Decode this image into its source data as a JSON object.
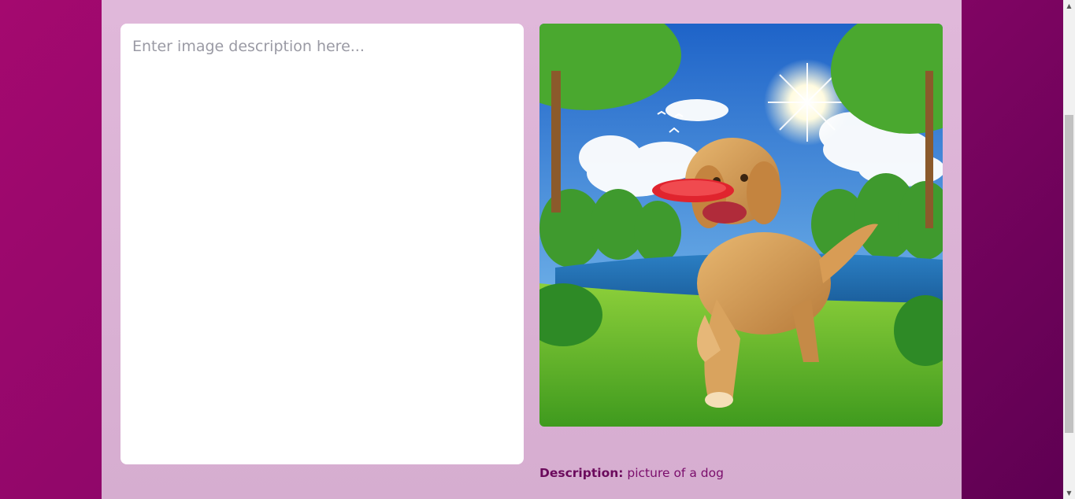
{
  "form": {
    "description_placeholder": "Enter image description here..."
  },
  "image": {
    "subject": "golden retriever with red frisbee in park",
    "alt": "picture of a dog"
  },
  "caption": {
    "label": "Description:",
    "value": "picture of a dog"
  },
  "colors": {
    "background_start": "#a4096f",
    "background_end": "#5e0052",
    "panel": "#dcb3d6",
    "caption_text": "#7a0d6b"
  }
}
